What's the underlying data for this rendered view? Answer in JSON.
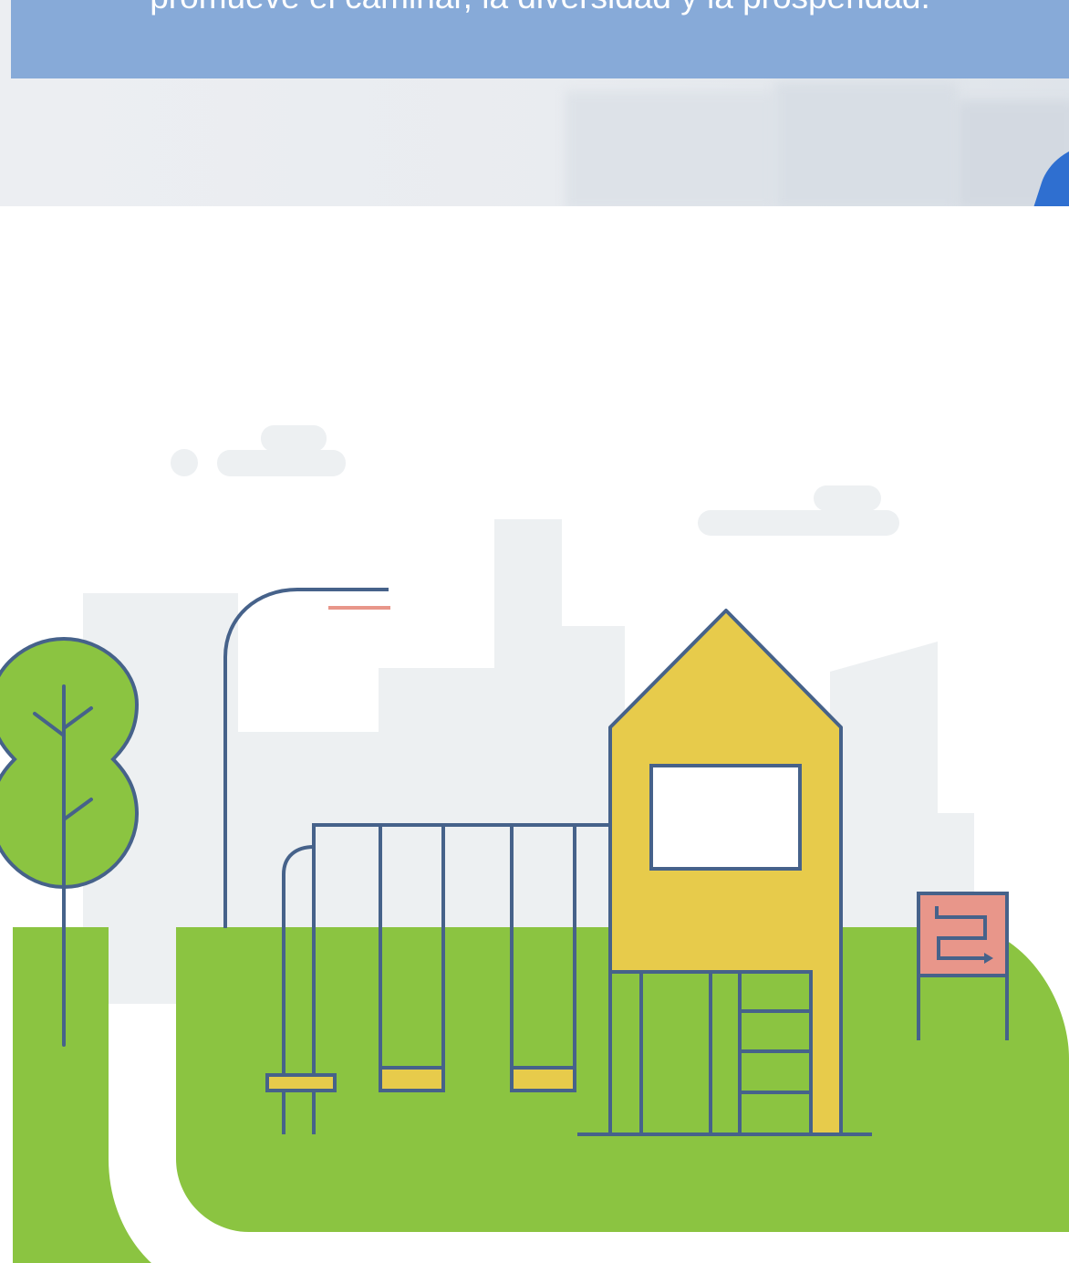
{
  "banner": {
    "text": "promueve el caminar, la diversidad y la prosperidad."
  },
  "illustration": {
    "subject": "playground-scene",
    "colors": {
      "grass": "#8bc441",
      "outline": "#46628a",
      "house": "#e7cb4b",
      "sign": "#e8968a",
      "skyline": "#edf0f2",
      "path": "#edf0f2",
      "banner": "#87aad8"
    }
  }
}
